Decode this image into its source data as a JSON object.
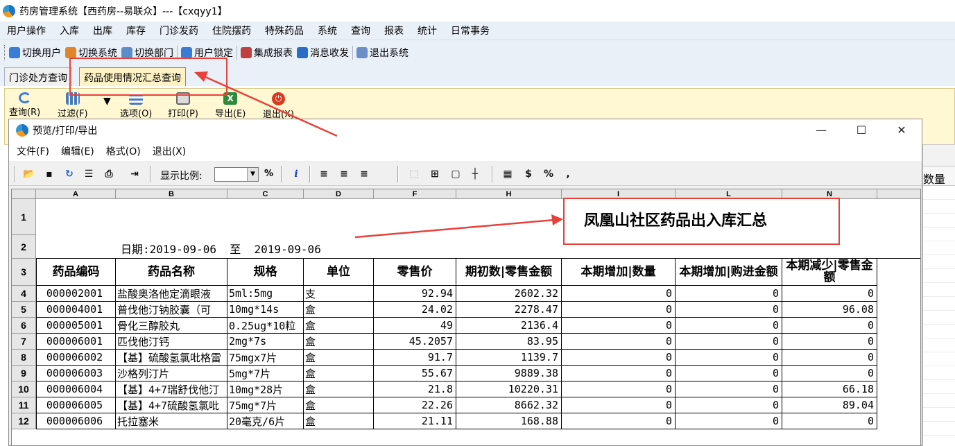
{
  "window": {
    "title": "药房管理系统【西药房--易联众】---【cxqyy1】"
  },
  "menu": [
    "用户操作",
    "入库",
    "出库",
    "库存",
    "门诊发药",
    "住院摆药",
    "特殊药品",
    "系统",
    "查询",
    "报表",
    "统计",
    "日常事务"
  ],
  "toolbar": [
    {
      "label": "切换用户",
      "icon": "users-icon",
      "color": "#3a7bd5"
    },
    {
      "label": "切换系统",
      "icon": "switch-system-icon",
      "color": "#e0862a"
    },
    {
      "label": "切换部门",
      "icon": "department-icon",
      "color": "#5b8ec9"
    },
    {
      "label": "用户锁定",
      "icon": "user-lock-icon",
      "color": "#3a7bd5"
    },
    {
      "label": "集成报表",
      "icon": "report-icon",
      "color": "#c04040"
    },
    {
      "label": "消息收发",
      "icon": "info-icon",
      "color": "#2b6cc4"
    },
    {
      "label": "退出系统",
      "icon": "exit-icon",
      "color": "#6a8fc8"
    }
  ],
  "tabs": [
    {
      "label": "门诊处方查询",
      "active": false
    },
    {
      "label": "药品使用情况汇总查询",
      "active": true
    }
  ],
  "query_toolbar": [
    {
      "label": "查询(R)",
      "icon": "refresh-icon",
      "color": "#3b7dd8"
    },
    {
      "label": "过滤(F)",
      "icon": "filter-icon",
      "color": "#4a7ab8"
    },
    {
      "label": "选项(O)",
      "icon": "options-icon",
      "color": "#4a7ab8"
    },
    {
      "label": "打印(P)",
      "icon": "printer-icon",
      "color": "#666666"
    },
    {
      "label": "导出(E)",
      "icon": "excel-export-icon",
      "color": "#2e8b3a"
    },
    {
      "label": "退出(X)",
      "icon": "power-icon",
      "color": "#d93a1f"
    }
  ],
  "background_grid_header": "数量",
  "dialog": {
    "title": "预览/打印/导出",
    "menu": [
      "文件(F)",
      "编辑(E)",
      "格式(O)",
      "退出(X)"
    ],
    "zoom_label": "显示比例:",
    "zoom_value": "",
    "zoom_unit": "%"
  },
  "sheet": {
    "column_letters": [
      "A",
      "B",
      "C",
      "D",
      "F",
      "H",
      "I",
      "L",
      "N"
    ],
    "title": "凤凰山社区药品出入库汇总",
    "date_range": "日期:2019-09-06  至  2019-09-06",
    "headers": [
      "药品编码",
      "药品名称",
      "规格",
      "单位",
      "零售价",
      "期初数|零售金额",
      "本期增加|数量",
      "本期增加|购进金额",
      "本期减少|零售金额"
    ],
    "rows": [
      {
        "n": "4",
        "cells": [
          "000002001",
          "盐酸奥洛他定滴眼液",
          "5ml:5mg",
          "支",
          "92.94",
          "2602.32",
          "0",
          "0",
          "0"
        ]
      },
      {
        "n": "5",
        "cells": [
          "000004001",
          "普伐他汀钠胶囊（可",
          "10mg*14s",
          "盒",
          "24.02",
          "2278.47",
          "0",
          "0",
          "96.08"
        ]
      },
      {
        "n": "6",
        "cells": [
          "000005001",
          "骨化三醇胶丸",
          "0.25ug*10粒",
          "盒",
          "49",
          "2136.4",
          "0",
          "0",
          "0"
        ]
      },
      {
        "n": "7",
        "cells": [
          "000006001",
          "匹伐他汀钙",
          "2mg*7s",
          "盒",
          "45.2057",
          "83.95",
          "0",
          "0",
          "0"
        ]
      },
      {
        "n": "8",
        "cells": [
          "000006002",
          "【基】硫酸氢氯吡格雷",
          "75mgx7片",
          "盒",
          "91.7",
          "1139.7",
          "0",
          "0",
          "0"
        ]
      },
      {
        "n": "9",
        "cells": [
          "000006003",
          "沙格列汀片",
          "5mg*7片",
          "盒",
          "55.67",
          "9889.38",
          "0",
          "0",
          "0"
        ]
      },
      {
        "n": "10",
        "cells": [
          "000006004",
          "【基】4+7瑞舒伐他汀",
          "10mg*28片",
          "盒",
          "21.8",
          "10220.31",
          "0",
          "0",
          "66.18"
        ]
      },
      {
        "n": "11",
        "cells": [
          "000006005",
          "【基】4+7硫酸氢氯吡",
          "75mg*7片",
          "盒",
          "22.26",
          "8662.32",
          "0",
          "0",
          "89.04"
        ]
      },
      {
        "n": "12",
        "cells": [
          "000006006",
          "托拉塞米",
          "20毫克/6片",
          "盒",
          "21.11",
          "168.88",
          "0",
          "0",
          "0"
        ]
      }
    ]
  },
  "annotation_color": "#e8413b"
}
